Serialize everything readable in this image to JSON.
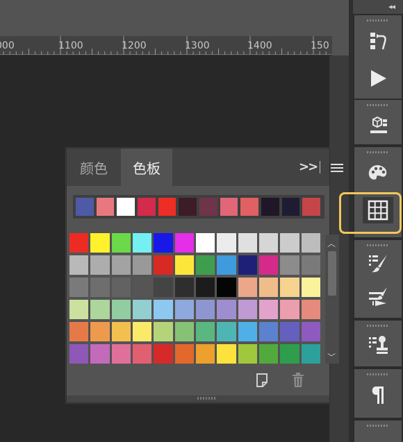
{
  "ruler": {
    "labels": [
      "000",
      "1100",
      "1200",
      "1300",
      "1400",
      "150"
    ]
  },
  "panel": {
    "tabs": [
      {
        "label": "颜色",
        "active": false
      },
      {
        "label": "色板",
        "active": true
      }
    ],
    "more_label": ">>",
    "recent_swatches": [
      "#4e5aa6",
      "#e8787e",
      "#ffffff",
      "#d42a4c",
      "#ee2d25",
      "#3c1c26",
      "#6e344a",
      "#e06678",
      "#e16062",
      "#1f1628",
      "#1e1c32",
      "#c64548"
    ],
    "swatch_rows": [
      [
        "#ec2b24",
        "#fff22c",
        "#6bd94a",
        "#74f0f2",
        "#1818e8",
        "#e42ee8",
        "#ffffff",
        "#ececec",
        "#e0e0e0",
        "#d6d6d6",
        "#cccccc",
        "#bdbdbd"
      ],
      [
        "#b9b9b9",
        "#adadad",
        "#a3a3a3",
        "#999999",
        "#d62a22",
        "#fde63a",
        "#3e9e4e",
        "#3f9ade",
        "#1e2078",
        "#d62a8a",
        "#8c8c8c",
        "#7a7a7a"
      ],
      [
        "#7a7a7a",
        "#6e6e6e",
        "#626262",
        "#555555",
        "#444444",
        "#2e2e2e",
        "#1c1c1c",
        "#050505",
        "#eca78a",
        "#f0bd8a",
        "#f6d38e",
        "#fbf29c"
      ],
      [
        "#cbe19e",
        "#acd69c",
        "#92cda2",
        "#93cfd0",
        "#8dc8f0",
        "#8fa9de",
        "#8e96d2",
        "#9e8ed0",
        "#c09ad2",
        "#e3a2cc",
        "#ec9eae",
        "#e58a7c"
      ],
      [
        "#e57a48",
        "#ed9a4c",
        "#f3c050",
        "#fbea6a",
        "#b5d47a",
        "#86c276",
        "#58b880",
        "#4eb6b2",
        "#4eb0e6",
        "#5b82ce",
        "#6560c0",
        "#8f5ac0"
      ],
      [
        "#8f58b6",
        "#c46aba",
        "#e0709a",
        "#e06072",
        "#d62a2a",
        "#e2682c",
        "#eda02c",
        "#fbe23c",
        "#a0c83c",
        "#52aa3c",
        "#2e9e4c",
        "#2ca09a"
      ]
    ]
  },
  "dock": {
    "buttons": [
      {
        "icon": "history-icon"
      },
      {
        "icon": "play-actions-icon"
      },
      {
        "icon": "3d-icon"
      },
      {
        "icon": "color-palette-icon"
      },
      {
        "icon": "swatches-grid-icon",
        "active": true
      },
      {
        "icon": "brush-settings-icon"
      },
      {
        "icon": "brush-presets-icon"
      },
      {
        "icon": "clone-source-icon"
      },
      {
        "icon": "paragraph-icon"
      }
    ]
  }
}
